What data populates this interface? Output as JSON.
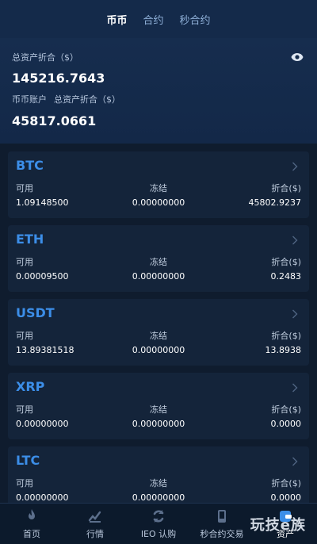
{
  "tabs": [
    {
      "label": "币币"
    },
    {
      "label": "合约"
    },
    {
      "label": "秒合约"
    }
  ],
  "summary": {
    "total_label": "总资产折合（$）",
    "total_value": "145216.7643",
    "account_label": "币币账户",
    "account_total_label": "总资产折合（$）",
    "account_value": "45817.0661"
  },
  "column_labels": {
    "available": "可用",
    "frozen": "冻结",
    "converted": "折合($)"
  },
  "assets": [
    {
      "name": "BTC",
      "available": "1.09148500",
      "frozen": "0.00000000",
      "converted": "45802.9237"
    },
    {
      "name": "ETH",
      "available": "0.00009500",
      "frozen": "0.00000000",
      "converted": "0.2483"
    },
    {
      "name": "USDT",
      "available": "13.89381518",
      "frozen": "0.00000000",
      "converted": "13.8938"
    },
    {
      "name": "XRP",
      "available": "0.00000000",
      "frozen": "0.00000000",
      "converted": "0.0000"
    },
    {
      "name": "LTC",
      "available": "0.00000000",
      "frozen": "0.00000000",
      "converted": "0.0000"
    }
  ],
  "nav": [
    {
      "label": "首页",
      "icon": "fire-icon"
    },
    {
      "label": "行情",
      "icon": "chart-icon"
    },
    {
      "label": "IEO 认购",
      "icon": "refresh-icon"
    },
    {
      "label": "秒合约交易",
      "icon": "phone-icon"
    },
    {
      "label": "资产",
      "icon": "wallet-icon"
    }
  ],
  "watermark": "玩技e族",
  "colors": {
    "accent": "#3c8ee8",
    "header_bg": "#142a4a",
    "card_bg": "#14243a",
    "page_bg": "#0f1c2e"
  }
}
